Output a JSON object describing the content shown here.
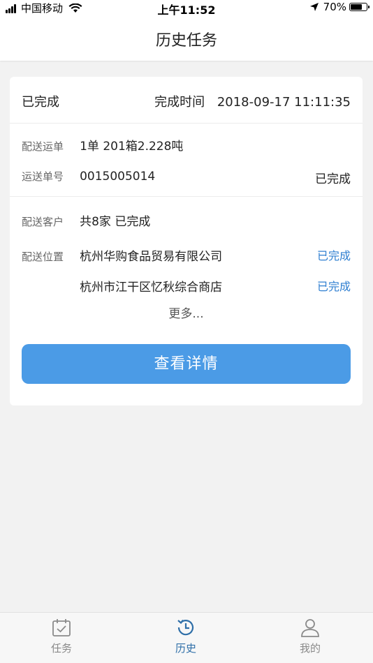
{
  "status_bar": {
    "carrier": "中国移动",
    "time": "上午11:52",
    "battery": "70%"
  },
  "header": {
    "title": "历史任务"
  },
  "card": {
    "status": "已完成",
    "time_label": "完成时间",
    "time_value": "2018-09-17 11:11:35",
    "delivery_waybill_label": "配送运单",
    "delivery_waybill_value": "1单 201箱2.228吨",
    "waybill_no_label": "运送单号",
    "waybill_no_value": "0015005014",
    "waybill_status": "已完成",
    "customer_label": "配送客户",
    "customer_value": "共8家 已完成",
    "location_label": "配送位置",
    "locations": [
      {
        "name": "杭州华购食品贸易有限公司",
        "status": "已完成"
      },
      {
        "name": "杭州市江干区忆秋综合商店",
        "status": "已完成"
      }
    ],
    "more_label": "更多...",
    "detail_button": "查看详情"
  },
  "tabs": [
    {
      "label": "任务"
    },
    {
      "label": "历史"
    },
    {
      "label": "我的"
    }
  ],
  "colors": {
    "accent": "#4b9be6",
    "link": "#2f7fd1",
    "tab_active": "#2f6fa8",
    "tab_inactive": "#8a8a8a"
  }
}
